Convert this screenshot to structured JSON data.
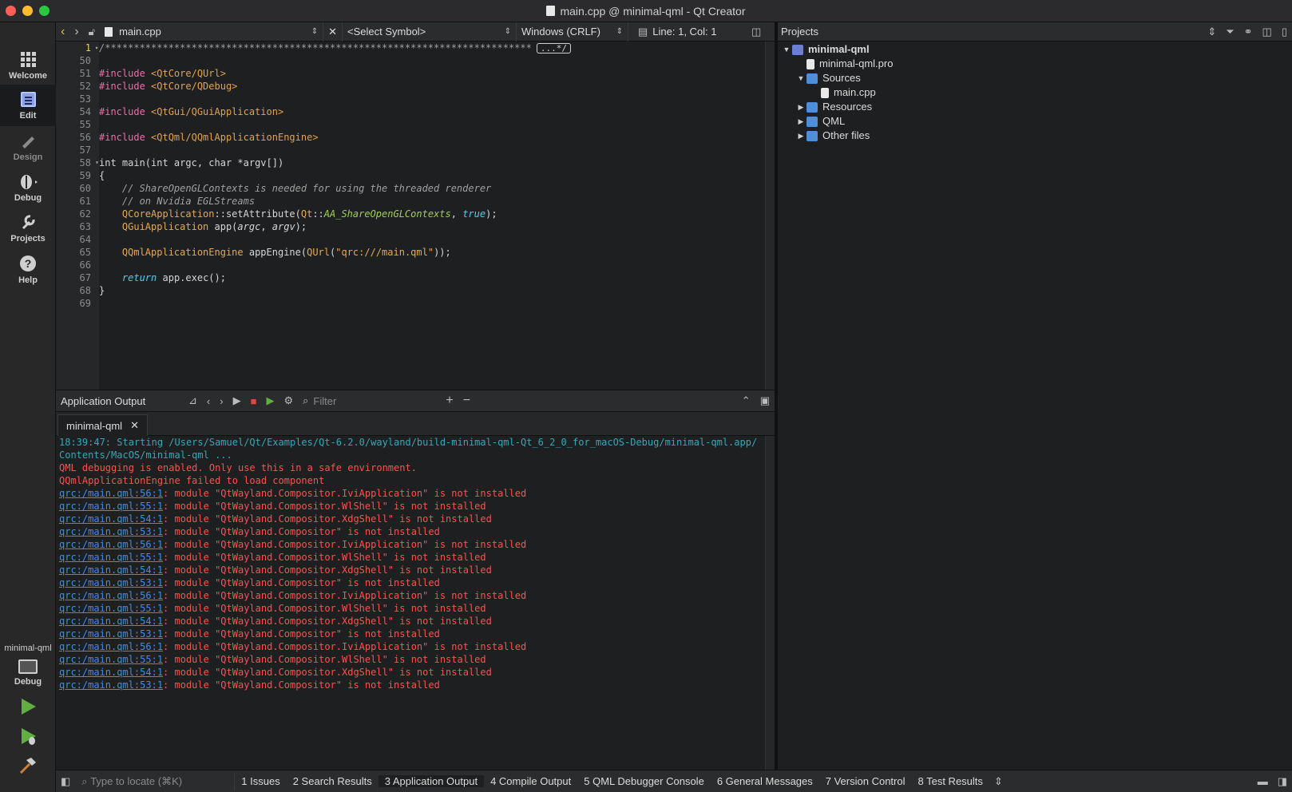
{
  "window": {
    "title": "main.cpp @ minimal-qml - Qt Creator"
  },
  "modes": [
    {
      "label": "Welcome",
      "icon": "welcome-grid-icon"
    },
    {
      "label": "Edit",
      "icon": "edit-document-icon"
    },
    {
      "label": "Design",
      "icon": "design-pen-icon"
    },
    {
      "label": "Debug",
      "icon": "debug-bug-icon"
    },
    {
      "label": "Projects",
      "icon": "projects-wrench-icon"
    },
    {
      "label": "Help",
      "icon": "help-circle-icon"
    }
  ],
  "kit": {
    "project": "minimal-qml",
    "config": "Debug"
  },
  "editor": {
    "file": "main.cpp",
    "symbol": "<Select Symbol>",
    "line_endings": "Windows (CRLF)",
    "position": "Line: 1, Col: 1",
    "folded_marker": "...*/",
    "first_line": "/**************************************************************************",
    "line_numbers": [
      "1",
      "50",
      "51",
      "52",
      "53",
      "54",
      "55",
      "56",
      "57",
      "58",
      "59",
      "60",
      "61",
      "62",
      "63",
      "64",
      "65",
      "66",
      "67",
      "68",
      "69"
    ]
  },
  "projects": {
    "title": "Projects",
    "root": "minimal-qml",
    "pro_file": "minimal-qml.pro",
    "sources": "Sources",
    "main_file": "main.cpp",
    "resources": "Resources",
    "qml": "QML",
    "other": "Other files"
  },
  "output_panel": {
    "title": "Application Output",
    "filter_placeholder": "Filter",
    "tab": "minimal-qml",
    "start_line1": "18:39:47: Starting /Users/Samuel/Qt/Examples/Qt-6.2.0/wayland/build-minimal-qml-Qt_6_2_0_for_macOS-Debug/minimal-qml.app/",
    "start_line2": "Contents/MacOS/minimal-qml ...",
    "debug_warning": "QML debugging is enabled. Only use this in a safe environment.",
    "load_fail": "QQmlApplicationEngine failed to load component",
    "errors": [
      {
        "link": "qrc:/main.qml:56:1",
        "msg": ": module \"QtWayland.Compositor.IviApplication\" is not installed"
      },
      {
        "link": "qrc:/main.qml:55:1",
        "msg": ": module \"QtWayland.Compositor.WlShell\" is not installed"
      },
      {
        "link": "qrc:/main.qml:54:1",
        "msg": ": module \"QtWayland.Compositor.XdgShell\" is not installed"
      },
      {
        "link": "qrc:/main.qml:53:1",
        "msg": ": module \"QtWayland.Compositor\" is not installed"
      },
      {
        "link": "qrc:/main.qml:56:1",
        "msg": ": module \"QtWayland.Compositor.IviApplication\" is not installed"
      },
      {
        "link": "qrc:/main.qml:55:1",
        "msg": ": module \"QtWayland.Compositor.WlShell\" is not installed"
      },
      {
        "link": "qrc:/main.qml:54:1",
        "msg": ": module \"QtWayland.Compositor.XdgShell\" is not installed"
      },
      {
        "link": "qrc:/main.qml:53:1",
        "msg": ": module \"QtWayland.Compositor\" is not installed"
      },
      {
        "link": "qrc:/main.qml:56:1",
        "msg": ": module \"QtWayland.Compositor.IviApplication\" is not installed"
      },
      {
        "link": "qrc:/main.qml:55:1",
        "msg": ": module \"QtWayland.Compositor.WlShell\" is not installed"
      },
      {
        "link": "qrc:/main.qml:54:1",
        "msg": ": module \"QtWayland.Compositor.XdgShell\" is not installed"
      },
      {
        "link": "qrc:/main.qml:53:1",
        "msg": ": module \"QtWayland.Compositor\" is not installed"
      },
      {
        "link": "qrc:/main.qml:56:1",
        "msg": ": module \"QtWayland.Compositor.IviApplication\" is not installed"
      },
      {
        "link": "qrc:/main.qml:55:1",
        "msg": ": module \"QtWayland.Compositor.WlShell\" is not installed"
      },
      {
        "link": "qrc:/main.qml:54:1",
        "msg": ": module \"QtWayland.Compositor.XdgShell\" is not installed"
      },
      {
        "link": "qrc:/main.qml:53:1",
        "msg": ": module \"QtWayland.Compositor\" is not installed"
      }
    ]
  },
  "statusbar": {
    "locate_placeholder": "Type to locate (⌘K)",
    "tabs": [
      "1  Issues",
      "2  Search Results",
      "3  Application Output",
      "4  Compile Output",
      "5  QML Debugger Console",
      "6  General Messages",
      "7  Version Control",
      "8  Test Results"
    ]
  },
  "colors": {
    "accent": "#e8d048",
    "error": "#ff4f4f",
    "link": "#3d8ef0",
    "start": "#34a8b8"
  }
}
